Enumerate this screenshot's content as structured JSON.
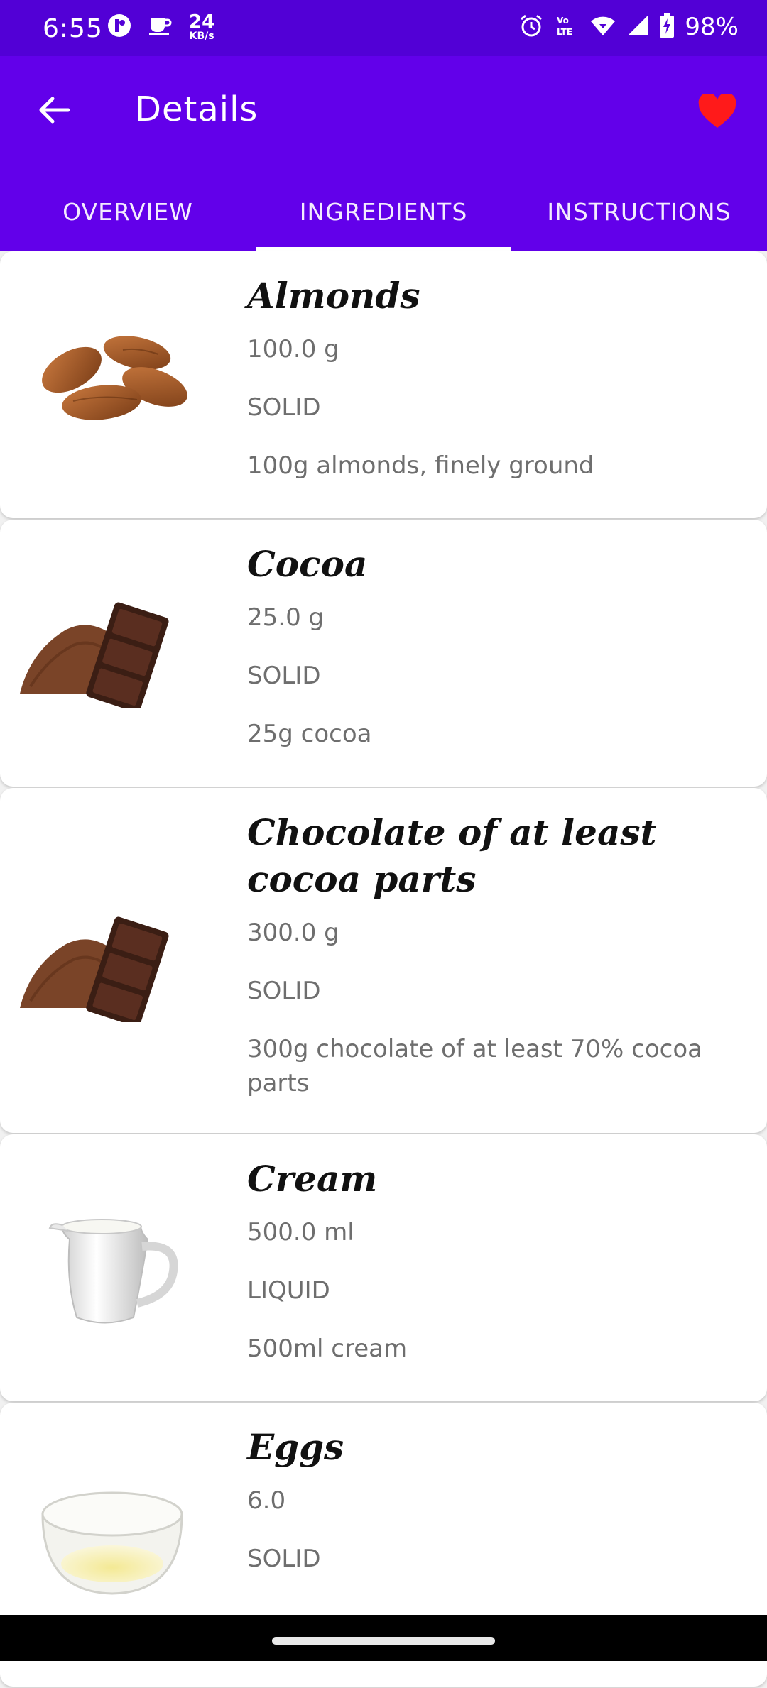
{
  "status_bar": {
    "time": "6:55",
    "net_speed_value": "24",
    "net_speed_unit": "KB/s",
    "battery": "98%",
    "icons": [
      "sync-icon",
      "coffee-cup-icon",
      "alarm-icon",
      "volte-icon",
      "wifi-icon",
      "cell-signal-icon",
      "battery-charging-icon"
    ]
  },
  "app_bar": {
    "title": "Details",
    "favorite_color": "#ff1a1a"
  },
  "tabs": [
    {
      "label": "OVERVIEW",
      "active": false
    },
    {
      "label": "INGREDIENTS",
      "active": true
    },
    {
      "label": "INSTRUCTIONS",
      "active": false
    }
  ],
  "ingredients": [
    {
      "name": "Almonds",
      "quantity": "100.0  g",
      "type": "SOLID",
      "description": "100g almonds, finely ground",
      "image": "almonds-image"
    },
    {
      "name": "Cocoa",
      "quantity": "25.0  g",
      "type": "SOLID",
      "description": "25g cocoa",
      "image": "cocoa-image"
    },
    {
      "name": "Chocolate of at least cocoa parts",
      "quantity": "300.0  g",
      "type": "SOLID",
      "description": "300g chocolate of at least 70% cocoa parts",
      "image": "cocoa-image"
    },
    {
      "name": "Cream",
      "quantity": "500.0  ml",
      "type": "LIQUID",
      "description": "500ml cream",
      "image": "cream-jug-image"
    },
    {
      "name": "Eggs",
      "quantity": "6.0",
      "type": "SOLID",
      "description": "",
      "image": "egg-bowl-image"
    }
  ],
  "colors": {
    "status_bar": "#5200d6",
    "app_bar": "#6200ea",
    "ingredient_name": "#111111",
    "ingredient_detail": "#6e6e6e"
  }
}
